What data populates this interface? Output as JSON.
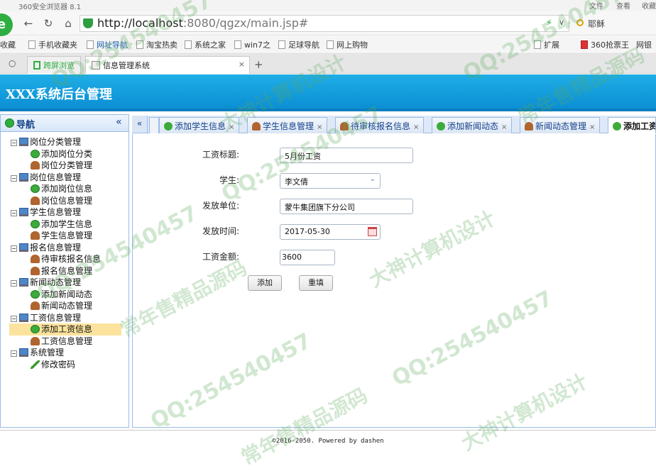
{
  "browser": {
    "title": "360安全浏览器 8.1",
    "menu": [
      "文件",
      "查看",
      "收藏"
    ],
    "url_host": "http://localhost",
    "url_rest": ":8080/qgzx/main.jsp#",
    "right_text": "耶稣",
    "bookmarks": [
      "收藏",
      "手机收藏夹",
      "网址导航",
      "淘宝热卖",
      "系统之家",
      "win7之",
      "足球导航",
      "网上购物"
    ],
    "bookmarks_right": [
      "扩展",
      "360抢票王",
      "网银"
    ],
    "tabs": [
      "跨屏浏览",
      "信息管理系统"
    ]
  },
  "app": {
    "title": "XXX系统后台管理",
    "nav_title": "导航",
    "nav_collapse": "«",
    "tree": [
      {
        "label": "岗位分类管理",
        "type": "group"
      },
      {
        "label": "添加岗位分类",
        "type": "add"
      },
      {
        "label": "岗位分类管理",
        "type": "user"
      },
      {
        "label": "岗位信息管理",
        "type": "group"
      },
      {
        "label": "添加岗位信息",
        "type": "add"
      },
      {
        "label": "岗位信息管理",
        "type": "user"
      },
      {
        "label": "学生信息管理",
        "type": "group"
      },
      {
        "label": "添加学生信息",
        "type": "add"
      },
      {
        "label": "学生信息管理",
        "type": "user"
      },
      {
        "label": "报名信息管理",
        "type": "group"
      },
      {
        "label": "待审核报名信息",
        "type": "user"
      },
      {
        "label": "报名信息管理",
        "type": "user"
      },
      {
        "label": "新闻动态管理",
        "type": "group"
      },
      {
        "label": "添加新闻动态",
        "type": "add"
      },
      {
        "label": "新闻动态管理",
        "type": "user"
      },
      {
        "label": "工资信息管理",
        "type": "group"
      },
      {
        "label": "添加工资信息",
        "type": "add",
        "selected": true
      },
      {
        "label": "工资信息管理",
        "type": "user"
      },
      {
        "label": "系统管理",
        "type": "group"
      },
      {
        "label": "修改密码",
        "type": "pen"
      }
    ],
    "tabs": [
      "添加学生信息",
      "学生信息管理",
      "待审核报名信息",
      "添加新闻动态",
      "新闻动态管理",
      "添加工资信息"
    ],
    "tab_scroll": "«"
  },
  "form": {
    "title_label": "工资标题:",
    "title_value": "5月份工资",
    "student_label": "学生:",
    "student_value": "李文倩",
    "unit_label": "发放单位:",
    "unit_value": "蒙牛集团旗下分公司",
    "time_label": "发放时间:",
    "time_value": "2017-05-30",
    "amount_label": "工资金额:",
    "amount_value": "3600",
    "add_button": "添加",
    "reset_button": "重填"
  },
  "footer": "©2016-2050. Powered by dashen",
  "watermarks": [
    "QQ:254540457",
    "大神计算机设计",
    "常年售精品源码"
  ],
  "colors": {
    "header": "#1faee6",
    "border": "#99bbe8",
    "selected": "#fbe39d"
  }
}
